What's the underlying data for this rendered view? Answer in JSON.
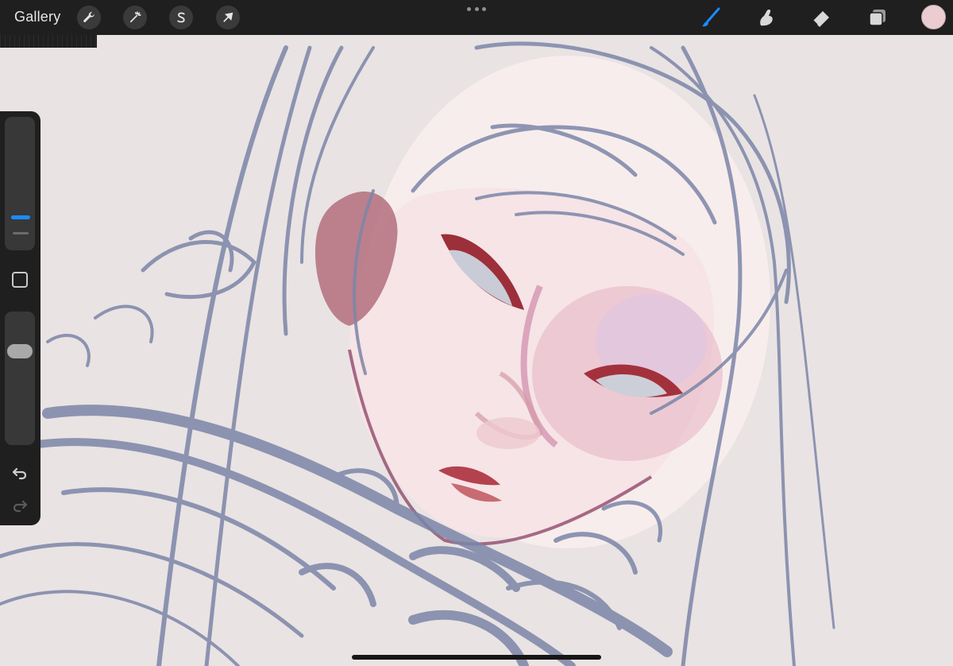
{
  "topbar": {
    "gallery_label": "Gallery",
    "left_tools": [
      "wrench-icon",
      "magic-wand-icon",
      "selection-s-icon",
      "move-arrow-icon"
    ],
    "right_tools": [
      "brush-icon",
      "smudge-icon",
      "eraser-icon",
      "layers-icon"
    ],
    "active_tool": "brush-icon",
    "accent_color": "#1b8bff",
    "current_color": "#ebccd1"
  },
  "sidebar": {
    "controls": [
      "brush-size-slider",
      "modify-button",
      "brush-opacity-slider",
      "undo-icon",
      "redo-icon"
    ]
  },
  "canvas": {
    "background_color": "#e9e3e3",
    "sketch_color": "#7c86a8"
  }
}
